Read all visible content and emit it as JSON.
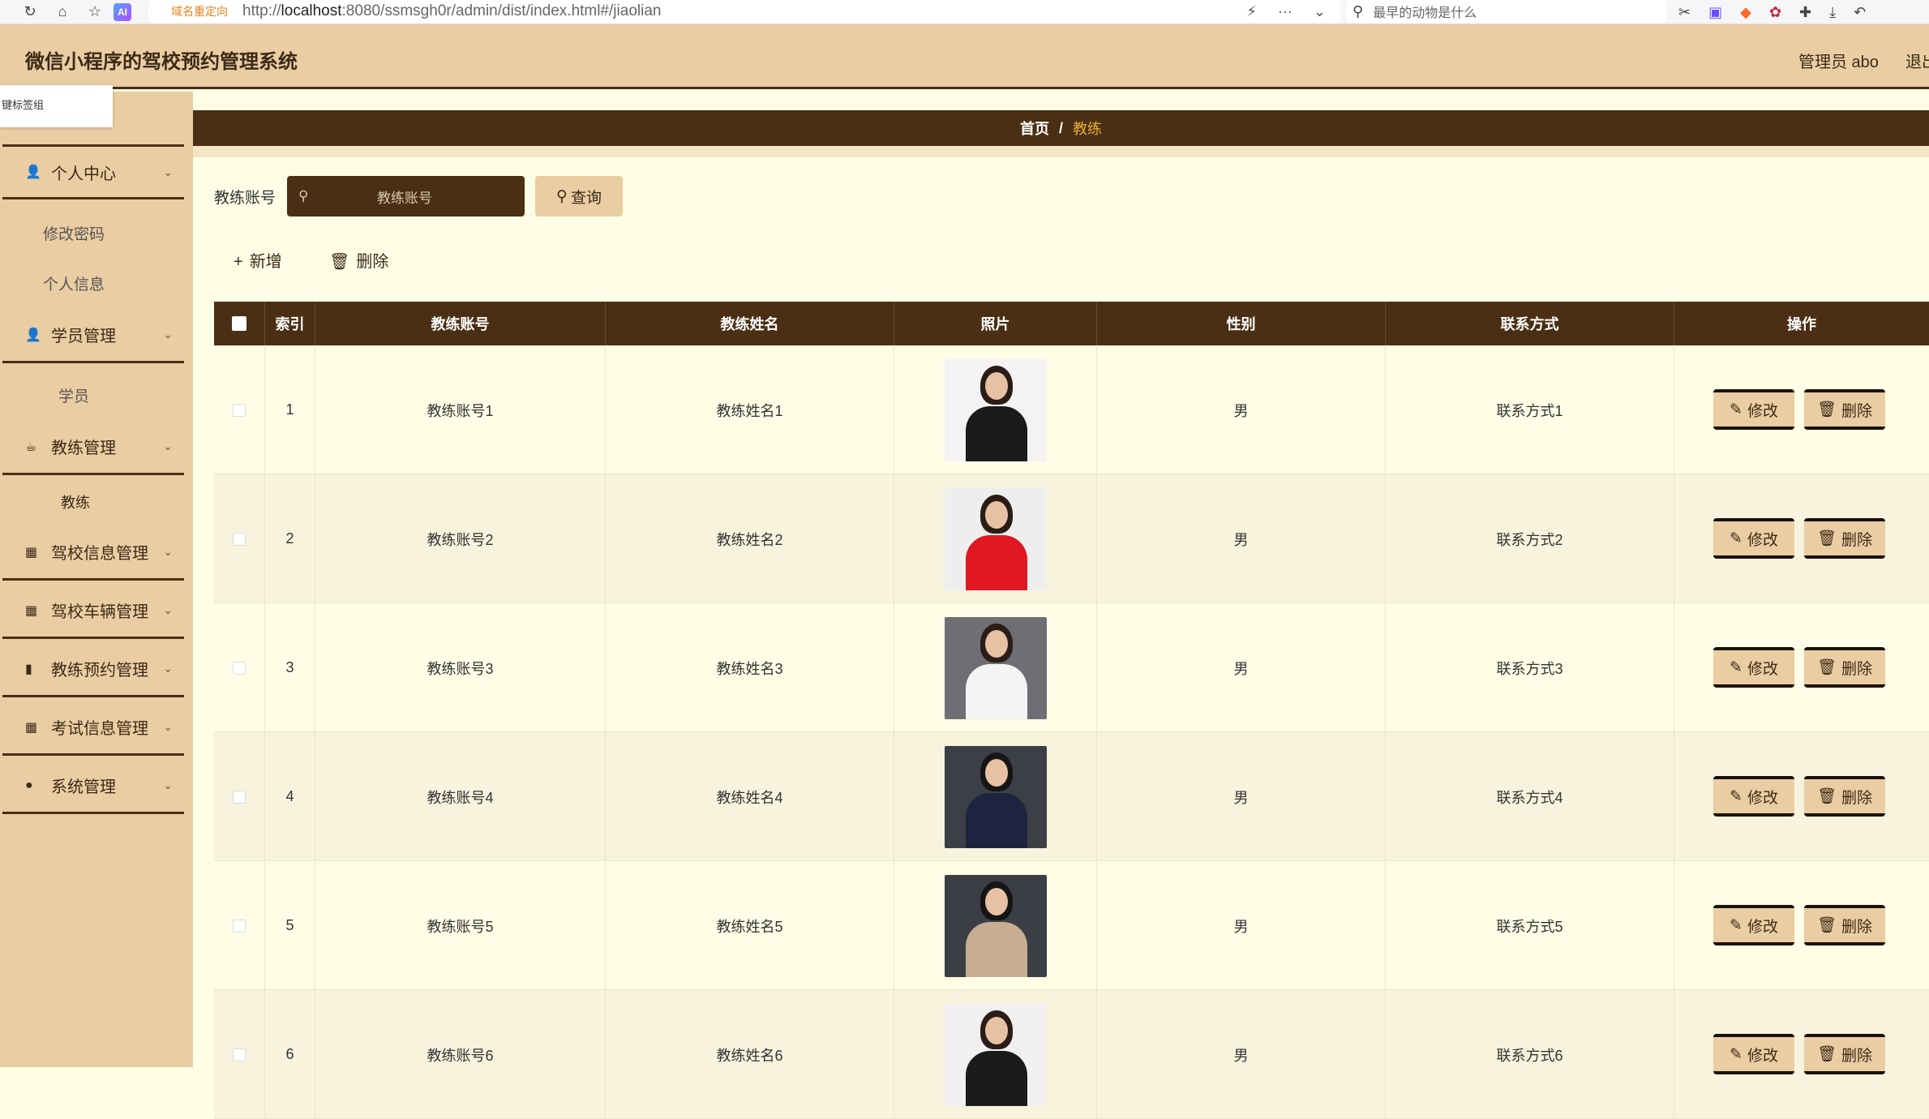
{
  "browser": {
    "redirect_label": "域名重定向",
    "url_prefix": "http://",
    "url_host": "localhost",
    "url_rest": ":8080/ssmsgh0r/admin/dist/index.html#/jiaolian",
    "search_text": "最早的动物是什么"
  },
  "header": {
    "title": "微信小程序的驾校预约管理系统",
    "user": "管理员 abo",
    "logout": "退出"
  },
  "tag_group": "键标签组",
  "sidebar": {
    "menus": [
      {
        "label": "个人中心",
        "icon": "👤",
        "subs": [
          "修改密码",
          "个人信息"
        ]
      },
      {
        "label": "学员管理",
        "icon": "👤",
        "subs": [
          "学员"
        ]
      },
      {
        "label": "教练管理",
        "icon": "☕",
        "subs": [
          "教练"
        ]
      },
      {
        "label": "驾校信息管理",
        "icon": "▦",
        "subs": []
      },
      {
        "label": "驾校车辆管理",
        "icon": "▦",
        "subs": []
      },
      {
        "label": "教练预约管理",
        "icon": "▮",
        "subs": []
      },
      {
        "label": "考试信息管理",
        "icon": "▦",
        "subs": []
      },
      {
        "label": "系统管理",
        "icon": "●",
        "subs": []
      }
    ]
  },
  "breadcrumb": {
    "home": "首页",
    "separator": "/",
    "current": "教练"
  },
  "filter": {
    "label": "教练账号",
    "placeholder": "教练账号",
    "query_button": "查询"
  },
  "actions": {
    "add": "新增",
    "delete": "删除"
  },
  "table": {
    "headers": [
      "索引",
      "教练账号",
      "教练姓名",
      "照片",
      "性别",
      "联系方式",
      "操作"
    ],
    "edit_label": "修改",
    "delete_label": "删除",
    "rows": [
      {
        "index": "1",
        "account": "教练账号1",
        "name": "教练姓名1",
        "gender": "男",
        "contact": "联系方式1"
      },
      {
        "index": "2",
        "account": "教练账号2",
        "name": "教练姓名2",
        "gender": "男",
        "contact": "联系方式2"
      },
      {
        "index": "3",
        "account": "教练账号3",
        "name": "教练姓名3",
        "gender": "男",
        "contact": "联系方式3"
      },
      {
        "index": "4",
        "account": "教练账号4",
        "name": "教练姓名4",
        "gender": "男",
        "contact": "联系方式4"
      },
      {
        "index": "5",
        "account": "教练账号5",
        "name": "教练姓名5",
        "gender": "男",
        "contact": "联系方式5"
      },
      {
        "index": "6",
        "account": "教练账号6",
        "name": "教练姓名6",
        "gender": "男",
        "contact": "联系方式6"
      }
    ]
  },
  "colors": {
    "primary_dark": "#4a2f14",
    "sidebar": "#eacda3",
    "background": "#fefde6",
    "breadcrumb_active": "#e8b03a"
  }
}
